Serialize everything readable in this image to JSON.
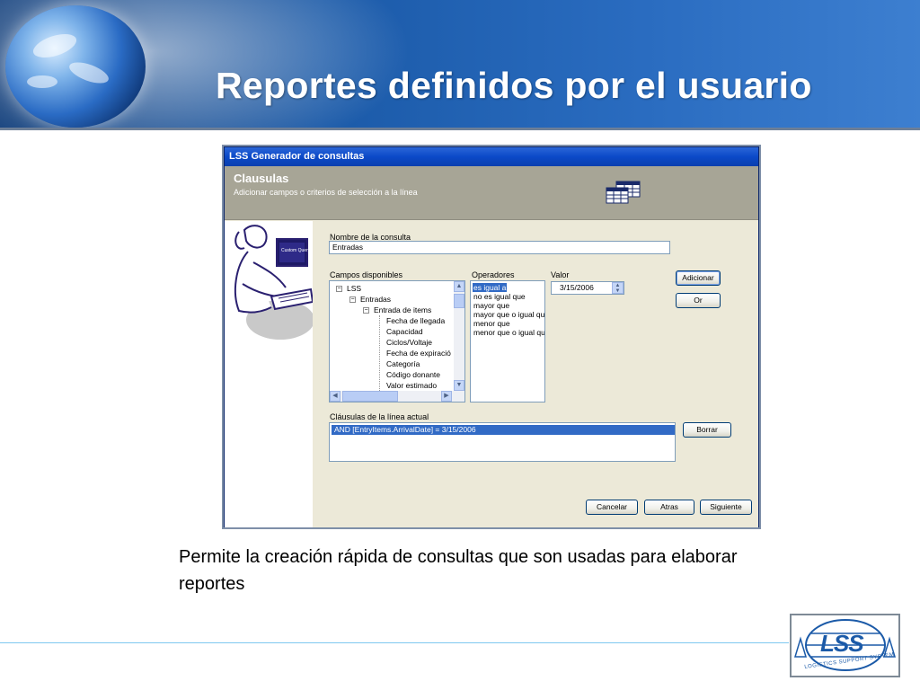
{
  "slide": {
    "title": "Reportes definidos por el usuario",
    "caption": "Permite la creación rápida de consultas que son usadas para elaborar reportes"
  },
  "dialog": {
    "window_title": "LSS Generador de consultas",
    "heading": "Clausulas",
    "subheading": "Adicionar campos o criterios de selección a la línea",
    "side_art_label": "Custom Query",
    "query_name": {
      "label": "Nombre de la consulta",
      "value": "Entradas"
    },
    "fields": {
      "label": "Campos disponibles",
      "root": "LSS",
      "level1": "Entradas",
      "level2": "Entrada de items",
      "items": [
        "Fecha de llegada",
        "Capacidad",
        "Ciclos/Voltaje",
        "Fecha de expiració",
        "Categoría",
        "Código donante",
        "Valor estimado"
      ]
    },
    "operators": {
      "label": "Operadores",
      "items": [
        "es igual a",
        "no es igual que",
        "mayor que",
        "mayor que o igual qu",
        "menor que",
        "menor que o igual qu"
      ],
      "selected": "es igual a"
    },
    "value": {
      "label": "Valor",
      "date": "3/15/2006"
    },
    "buttons": {
      "add": "Adicionar",
      "or": "Or",
      "delete": "Borrar",
      "cancel": "Cancelar",
      "back": "Atras",
      "next": "Siguiente"
    },
    "clauses": {
      "label": "Cláusulas de la línea actual",
      "items": [
        "AND  [EntryItems.ArrivalDate] = 3/15/2006"
      ]
    }
  },
  "logo": {
    "text": "LSS",
    "subtext": "LOGISTICS SUPPORT SYSTEM"
  },
  "colors": {
    "header_blue": "#1b5aa8",
    "selection_blue": "#316ac5",
    "dialog_face": "#ece9d8",
    "wizard_band": "#a7a596"
  }
}
